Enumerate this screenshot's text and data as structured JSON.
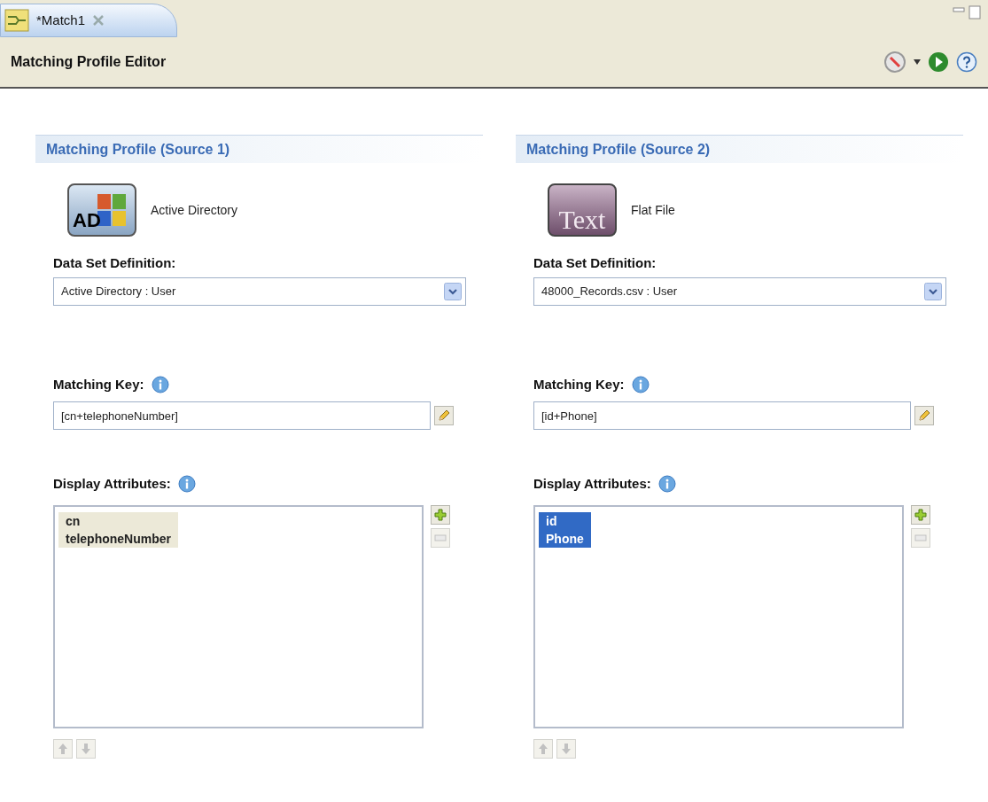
{
  "tab": {
    "title": "*Match1"
  },
  "editor": {
    "title": "Matching Profile Editor"
  },
  "panels": [
    {
      "header": "Matching Profile (Source 1)",
      "kind": "ad",
      "icon_text": "AD",
      "source_name": "Active Directory",
      "dataset_label": "Data Set Definition:",
      "dataset_value": "Active Directory : User",
      "key_label": "Matching Key:",
      "key_value": "[cn+telephoneNumber]",
      "attrs_label": "Display Attributes:",
      "focused": false,
      "attributes": [
        {
          "name": "cn",
          "selected": true
        },
        {
          "name": "telephoneNumber",
          "selected": true
        }
      ]
    },
    {
      "header": "Matching Profile (Source 2)",
      "kind": "text",
      "icon_text": "Text",
      "source_name": "Flat File",
      "dataset_label": "Data Set Definition:",
      "dataset_value": "48000_Records.csv : User",
      "key_label": "Matching Key:",
      "key_value": "[id+Phone]",
      "attrs_label": "Display Attributes:",
      "focused": true,
      "attributes": [
        {
          "name": "id",
          "selected": true
        },
        {
          "name": "Phone",
          "selected": true
        }
      ]
    }
  ]
}
